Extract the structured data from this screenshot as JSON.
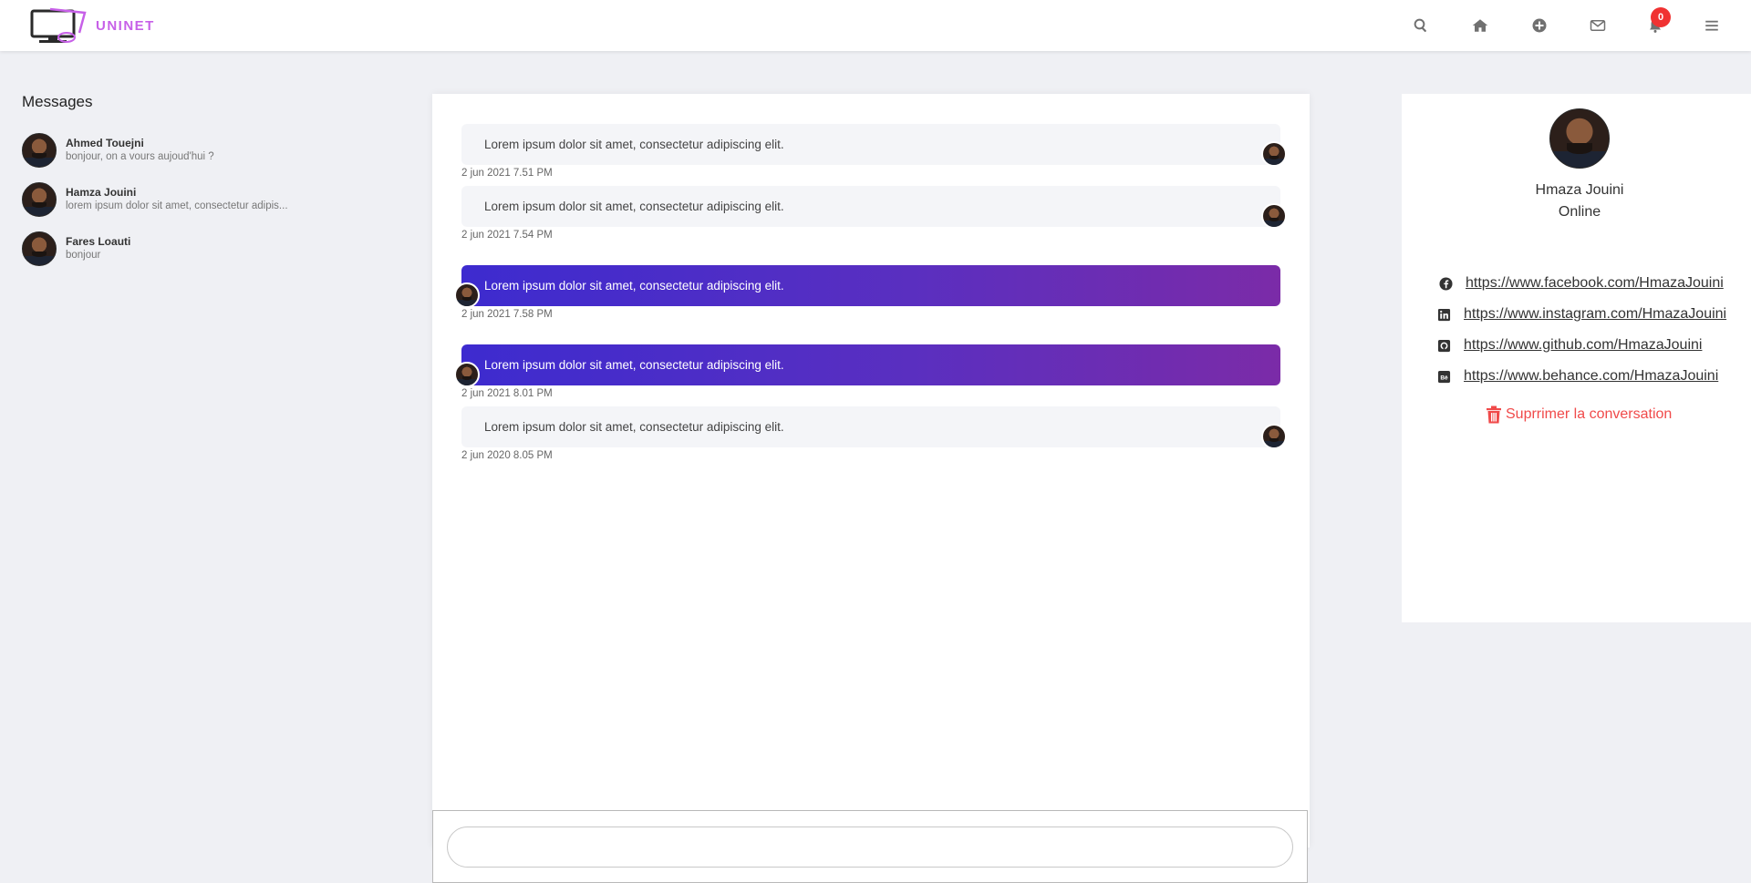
{
  "brand": {
    "name": "UNINET",
    "accent": "#c760e8"
  },
  "navbar": {
    "icons": [
      "search-icon",
      "home-icon",
      "plus-circle-icon",
      "envelope-icon",
      "bell-icon",
      "menu-icon"
    ],
    "notification_count": "0"
  },
  "sidebar": {
    "title": "Messages",
    "conversations": [
      {
        "name": "Ahmed Touejni",
        "preview": "bonjour, on a vours aujoud'hui ?"
      },
      {
        "name": "Hamza Jouini",
        "preview": "lorem ipsum dolor sit amet, consectetur adipis..."
      },
      {
        "name": "Fares Loauti",
        "preview": "bonjour"
      }
    ]
  },
  "chat": {
    "messages": [
      {
        "direction": "received",
        "text": "Lorem ipsum dolor sit amet, consectetur adipiscing elit.",
        "time": "2 jun 2021 7.51 PM"
      },
      {
        "direction": "received",
        "text": "Lorem ipsum dolor sit amet, consectetur adipiscing elit.",
        "time": "2 jun 2021 7.54 PM"
      },
      {
        "direction": "sent",
        "text": "Lorem ipsum dolor sit amet, consectetur adipiscing elit.",
        "time": "2 jun 2021 7.58 PM"
      },
      {
        "direction": "sent",
        "text": "Lorem ipsum dolor sit amet, consectetur adipiscing elit.",
        "time": "2 jun 2021 8.01 PM"
      },
      {
        "direction": "received",
        "text": "Lorem ipsum dolor sit amet, consectetur adipiscing elit.",
        "time": "2 jun 2020 8.05 PM"
      }
    ],
    "input": {
      "value": "",
      "placeholder": ""
    },
    "colors": {
      "sent_start": "#3d2bcf",
      "sent_end": "#7b2ba8",
      "received_bg": "#f4f5f8"
    }
  },
  "profile": {
    "name": "Hmaza Jouini",
    "status": "Online",
    "links": [
      {
        "icon": "facebook-icon",
        "url": "https://www.facebook.com/HmazaJouini"
      },
      {
        "icon": "linkedin-icon",
        "url": "https://www.instagram.com/HmazaJouini"
      },
      {
        "icon": "github-icon",
        "url": "https://www.github.com/HmazaJouini"
      },
      {
        "icon": "behance-icon",
        "url": "https://www.behance.com/HmazaJouini"
      }
    ],
    "delete_label": "Suprrimer la conversation",
    "delete_color": "#f04a4a"
  }
}
